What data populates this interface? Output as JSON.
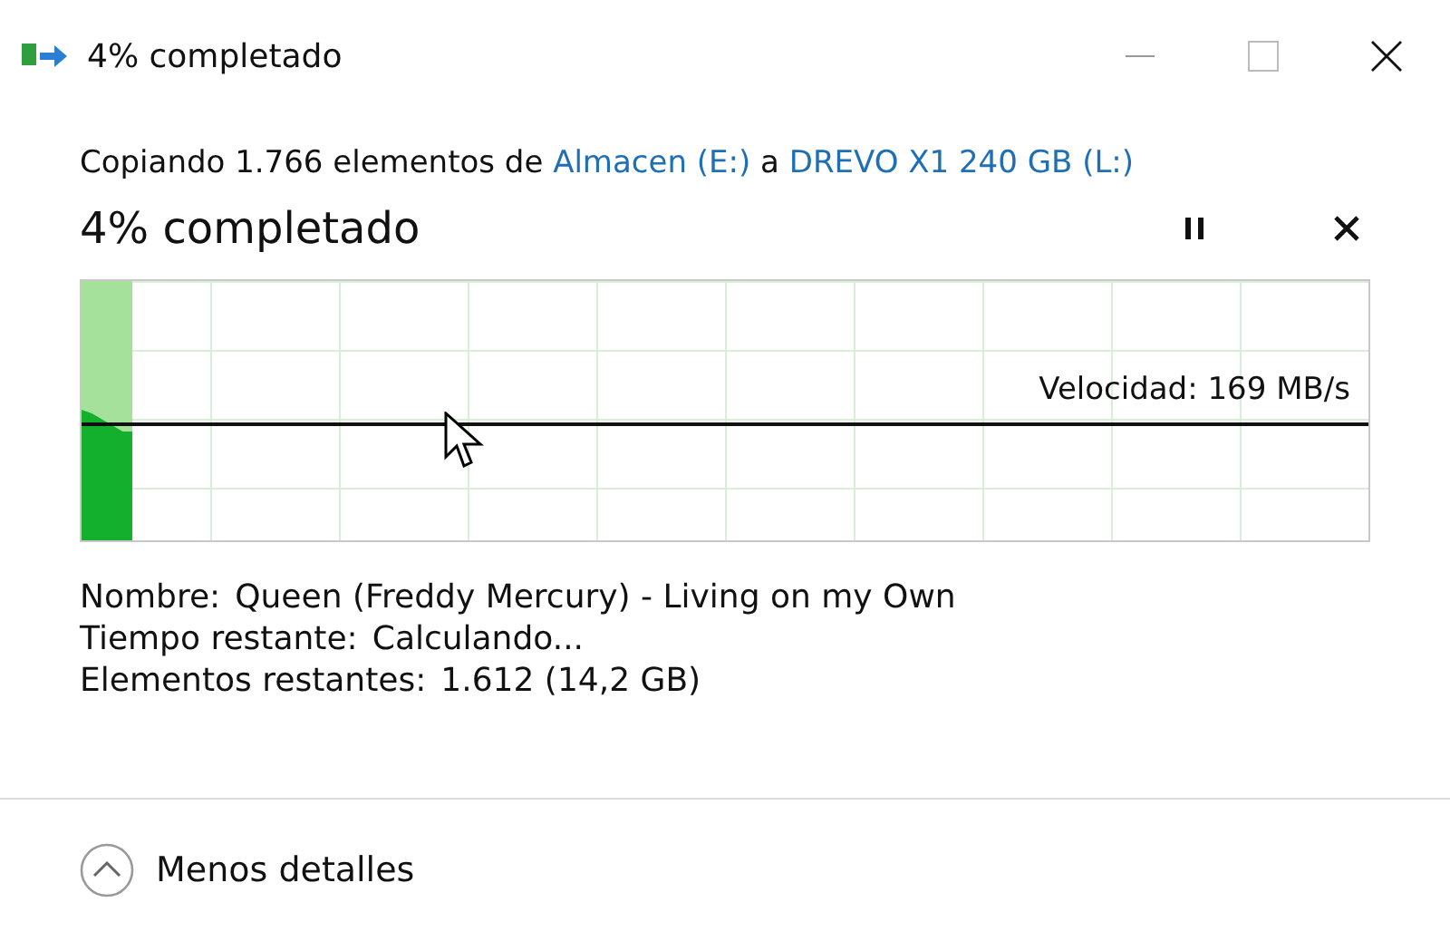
{
  "window": {
    "title": "4% completado"
  },
  "header": {
    "prefix": "Copiando 1.766 elementos de ",
    "source": "Almacen (E:)",
    "middle": " a ",
    "destination": "DREVO X1 240 GB (L:)"
  },
  "progress": {
    "title": "4% completado",
    "level": 0.04,
    "speed": "Velocidad: 169 MB/s"
  },
  "details": [
    {
      "label": "Nombre:",
      "value": "Queen (Freddy Mercury) - Living on my Own"
    },
    {
      "label": "Tiempo restante:",
      "value": "Calculando..."
    },
    {
      "label": "Elementos restantes:",
      "value": "1.612 (14,2 GB)"
    }
  ],
  "toggle": {
    "label": "Menos detalles",
    "expanded": true
  }
}
